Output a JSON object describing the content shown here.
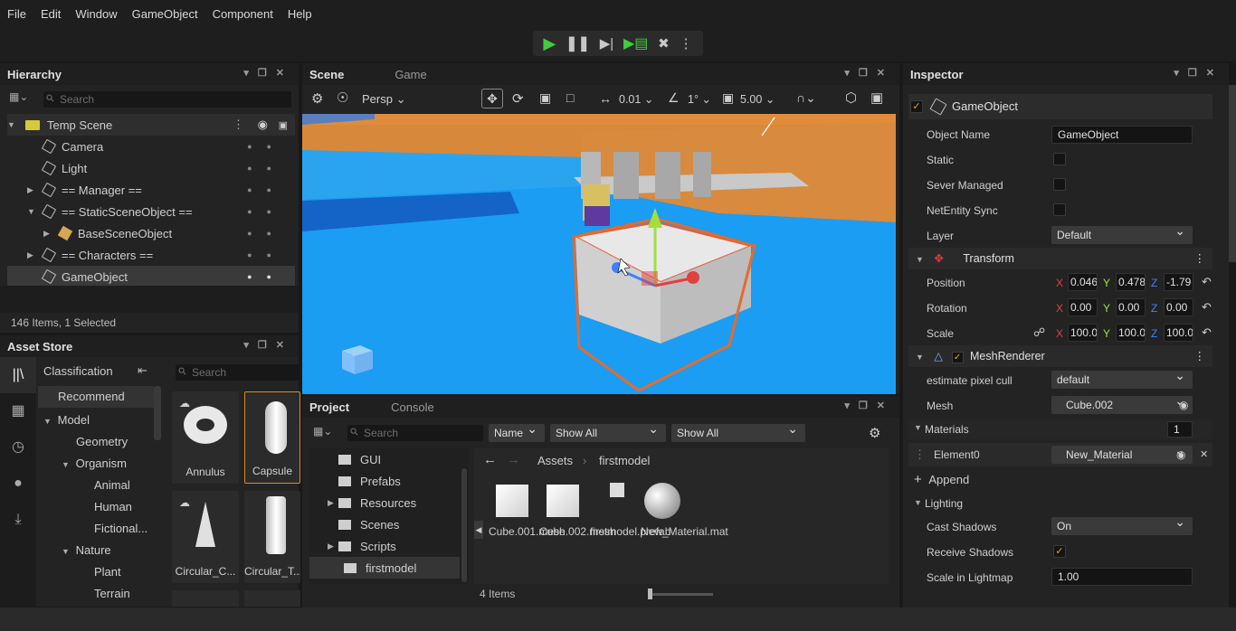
{
  "menu": [
    "File",
    "Edit",
    "Window",
    "GameObject",
    "Component",
    "Help"
  ],
  "hierarchy": {
    "title": "Hierarchy",
    "search_placeholder": "Search",
    "scene": "Temp Scene",
    "items": [
      "Camera",
      "Light",
      "== Manager ==",
      "== StaticSceneObject ==",
      "BaseSceneObject",
      "== Characters ==",
      "GameObject"
    ],
    "status": "146 Items, 1 Selected"
  },
  "asset_store": {
    "title": "Asset Store",
    "classification": "Classification",
    "search_placeholder": "Search",
    "tree": [
      "Recommend",
      "Model",
      "Geometry",
      "Organism",
      "Animal",
      "Human",
      "Fictional...",
      "Nature",
      "Plant",
      "Terrain"
    ],
    "cards": [
      "Annulus",
      "Capsule",
      "Circular_C...",
      "Circular_T..."
    ]
  },
  "scene": {
    "tab_scene": "Scene",
    "tab_game": "Game",
    "persp": "Persp",
    "snap_move": "0.01",
    "snap_angle": "1°",
    "snap_scale": "5.00"
  },
  "project": {
    "tab_project": "Project",
    "tab_console": "Console",
    "search_placeholder": "Search",
    "sort": "Name",
    "filter1": "Show All",
    "filter2": "Show All",
    "folders": [
      "GUI",
      "Prefabs",
      "Resources",
      "Scenes",
      "Scripts",
      "firstmodel"
    ],
    "breadcrumb_root": "Assets",
    "breadcrumb_current": "firstmodel",
    "files": [
      "Cube.001.mesh",
      "Cube.002.mesh",
      "firstmodel.prefab",
      "New_Material.mat"
    ],
    "status": "4 Items"
  },
  "inspector": {
    "title": "Inspector",
    "object": "GameObject",
    "object_name_label": "Object Name",
    "object_name_value": "GameObject",
    "static_label": "Static",
    "sever_label": "Sever Managed",
    "netentity_label": "NetEntity Sync",
    "layer_label": "Layer",
    "layer_value": "Default",
    "transform": "Transform",
    "position_label": "Position",
    "position": [
      "0.046",
      "0.478",
      "-1.79"
    ],
    "rotation_label": "Rotation",
    "rotation": [
      "0.00",
      "0.00",
      "0.00"
    ],
    "scale_label": "Scale",
    "scale": [
      "100.0",
      "100.0",
      "100.0"
    ],
    "mesh_renderer": "MeshRenderer",
    "cull_label": "estimate pixel cull",
    "cull_value": "default",
    "mesh_label": "Mesh",
    "mesh_value": "Cube.002",
    "materials_label": "Materials",
    "materials_count": "1",
    "element0_label": "Element0",
    "element0_value": "New_Material",
    "append": "Append",
    "lighting": "Lighting",
    "cast_label": "Cast Shadows",
    "cast_value": "On",
    "receive_label": "Receive Shadows",
    "lightmap_label": "Scale in Lightmap",
    "lightmap_value": "1.00"
  },
  "colors": {
    "accent": "#e66a2c",
    "sky": "#3aa0e8",
    "play": "#3fcc3f",
    "x": "#e04040",
    "y": "#a0e040",
    "z": "#4080ff"
  }
}
